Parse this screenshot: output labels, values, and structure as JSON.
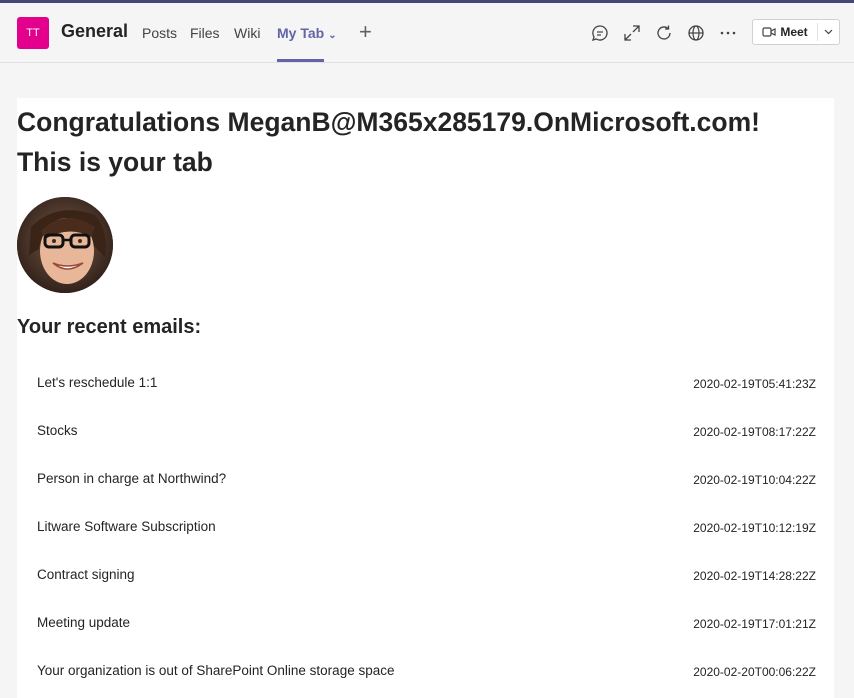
{
  "header": {
    "team_initials": "TT",
    "channel_name": "General",
    "tabs": [
      {
        "label": "Posts"
      },
      {
        "label": "Files"
      },
      {
        "label": "Wiki"
      },
      {
        "label": "My Tab"
      }
    ],
    "meet_label": "Meet",
    "accent_color": "#6264a7",
    "team_color": "#e3008c",
    "icons": [
      "chat-icon",
      "expand-icon",
      "refresh-icon",
      "globe-icon",
      "more-icon",
      "video-icon",
      "chevron-down-icon"
    ]
  },
  "main": {
    "title_line1": "Congratulations MeganB@M365x285179.OnMicrosoft.com!",
    "title_line2": "This is your tab",
    "emails_heading": "Your recent emails:",
    "emails": [
      {
        "subject": "Let's reschedule 1:1",
        "date": "2020-02-19T05:41:23Z"
      },
      {
        "subject": "Stocks",
        "date": "2020-02-19T08:17:22Z"
      },
      {
        "subject": "Person in charge at Northwind?",
        "date": "2020-02-19T10:04:22Z"
      },
      {
        "subject": "Litware Software Subscription",
        "date": "2020-02-19T10:12:19Z"
      },
      {
        "subject": "Contract signing",
        "date": "2020-02-19T14:28:22Z"
      },
      {
        "subject": "Meeting update",
        "date": "2020-02-19T17:01:21Z"
      },
      {
        "subject": "Your organization is out of SharePoint Online storage space",
        "date": "2020-02-20T00:06:22Z"
      }
    ]
  }
}
